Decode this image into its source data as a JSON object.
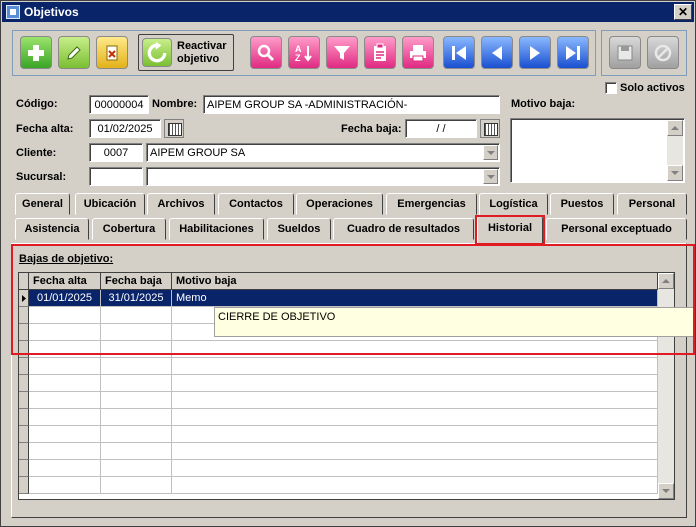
{
  "window": {
    "title": "Objetivos",
    "close_glyph": "✕"
  },
  "toolbar": {
    "add": "plus-icon",
    "edit": "pencil-icon",
    "delete": "delete-doc-icon",
    "reactivar_line1": "Reactivar",
    "reactivar_line2": "objetivo",
    "search": "magnifier-icon",
    "sort": "sort-az-icon",
    "sort_text": "AZ",
    "filter": "funnel-icon",
    "report": "clipboard-icon",
    "print": "printer-icon",
    "first": "first-icon",
    "prev": "prev-icon",
    "next": "next-icon",
    "last": "last-icon",
    "save": "save-icon",
    "cancel": "cancel-icon"
  },
  "form": {
    "codigo_label": "Código:",
    "codigo_value": "00000004",
    "nombre_label": "Nombre:",
    "nombre_value": "AIPEM GROUP SA -ADMINISTRACIÓN-",
    "fecha_alta_label": "Fecha alta:",
    "fecha_alta_value": "01/02/2025",
    "fecha_baja_label": "Fecha baja:",
    "fecha_baja_value": " /  /",
    "cliente_label": "Cliente:",
    "cliente_code": "0007",
    "cliente_name": "AIPEM GROUP SA",
    "sucursal_label": "Sucursal:",
    "sucursal_code": "",
    "sucursal_name": "",
    "motivo_baja_label": "Motivo baja:",
    "motivo_baja_value": "",
    "solo_activos_label": "Solo activos",
    "solo_activos_checked": false
  },
  "tabs_row1": [
    "General",
    "Ubicación",
    "Archivos",
    "Contactos",
    "Operaciones",
    "Emergencias",
    "Logística",
    "Puestos",
    "Personal"
  ],
  "tabs_row2": [
    "Asistencia",
    "Cobertura",
    "Habilitaciones",
    "Sueldos",
    "Cuadro de resultados",
    "Historial",
    "Personal exceptuado"
  ],
  "active_tab": "Historial",
  "historial": {
    "section_label": "Bajas de objetivo:",
    "columns": [
      "Fecha alta",
      "Fecha baja",
      "Motivo baja"
    ],
    "rows": [
      {
        "fecha_alta": "01/01/2025",
        "fecha_baja": "31/01/2025",
        "motivo": "Memo"
      }
    ],
    "tooltip": "CIERRE DE OBJETIVO"
  }
}
